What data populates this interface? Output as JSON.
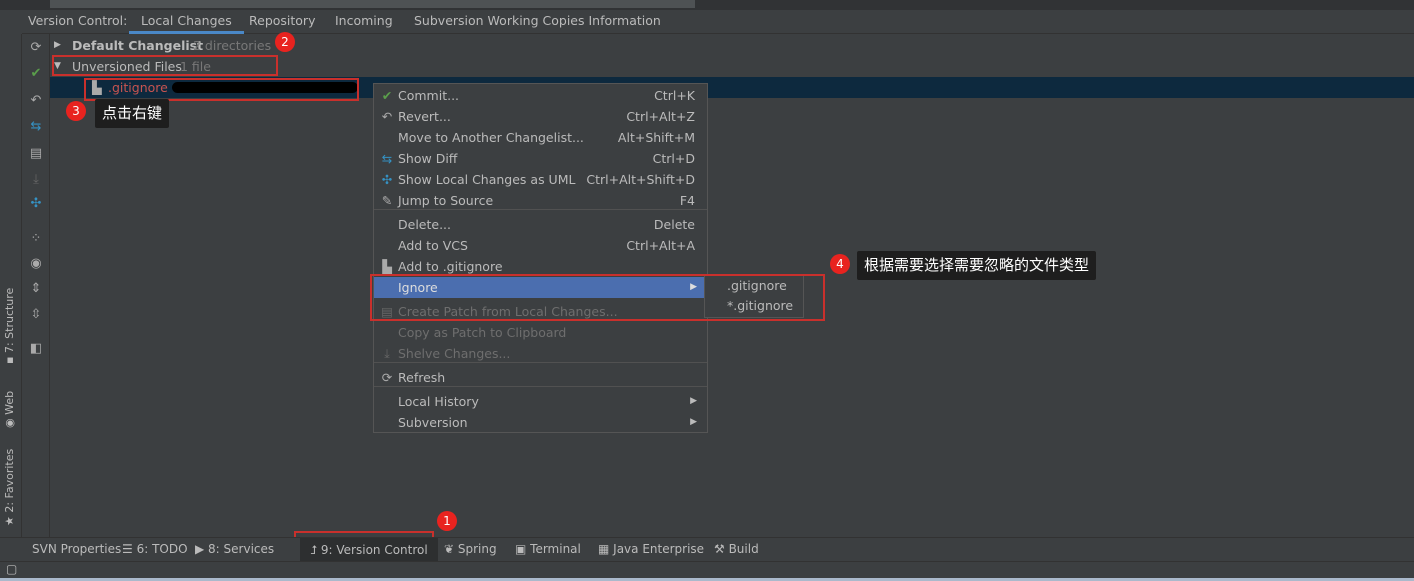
{
  "header": {
    "label": "Version Control:",
    "tabs": [
      {
        "label": "Local Changes",
        "active": true
      },
      {
        "label": "Repository"
      },
      {
        "label": "Incoming"
      },
      {
        "label": "Subversion Working Copies Information"
      }
    ]
  },
  "left_stripe": {
    "items": [
      {
        "label": "7: Structure",
        "icon": "structure-icon"
      },
      {
        "label": "Web",
        "icon": "globe-icon"
      },
      {
        "label": "2: Favorites",
        "icon": "star-icon"
      }
    ]
  },
  "toolbar": {
    "icons": [
      "refresh-icon",
      "commit-check-icon",
      "revert-icon",
      "show-diff-icon",
      "changelist-icon",
      "download-icon",
      "uml-icon",
      "group-icon",
      "eye-icon",
      "expand-all-icon",
      "collapse-all-icon",
      "preview-icon"
    ]
  },
  "tree": {
    "default_changelist": {
      "label": "Default Changelist",
      "meta": "2 directories"
    },
    "unversioned": {
      "label": "Unversioned Files",
      "meta": "1 file"
    },
    "file": {
      "name": ".gitignore"
    }
  },
  "context_menu": {
    "items": [
      {
        "label": "Commit...",
        "shortcut": "Ctrl+K",
        "icon": "check-icon"
      },
      {
        "label": "Revert...",
        "shortcut": "Ctrl+Alt+Z",
        "icon": "revert-icon"
      },
      {
        "label": "Move to Another Changelist...",
        "shortcut": "Alt+Shift+M"
      },
      {
        "label": "Show Diff",
        "shortcut": "Ctrl+D",
        "icon": "diff-icon"
      },
      {
        "label": "Show Local Changes as UML",
        "shortcut": "Ctrl+Alt+Shift+D",
        "icon": "uml-icon"
      },
      {
        "label": "Jump to Source",
        "shortcut": "F4",
        "icon": "edit-icon"
      },
      {
        "label": "Delete...",
        "shortcut": "Delete"
      },
      {
        "label": "Add to VCS",
        "shortcut": "Ctrl+Alt+A"
      },
      {
        "label": "Add to .gitignore",
        "icon": "gitignore-icon"
      },
      {
        "label": "Ignore",
        "submenu": true,
        "highlighted": true
      },
      {
        "label": "Create Patch from Local Changes...",
        "disabled": true,
        "icon": "patch-icon"
      },
      {
        "label": "Copy as Patch to Clipboard",
        "disabled": true
      },
      {
        "label": "Shelve Changes...",
        "disabled": true,
        "icon": "shelve-icon"
      },
      {
        "label": "Refresh",
        "icon": "refresh-icon"
      },
      {
        "label": "Local History",
        "submenu": true
      },
      {
        "label": "Subversion",
        "submenu": true
      }
    ]
  },
  "submenu": {
    "items": [
      ".gitignore",
      "*.gitignore"
    ]
  },
  "annotations": {
    "b1": "1",
    "b2": "2",
    "b3": "3",
    "b4": "4",
    "tip3": "点击右键",
    "tip4": "根据需要选择需要忽略的文件类型"
  },
  "bottom_bar": {
    "items": [
      {
        "label": "SVN Properties"
      },
      {
        "label": "6: TODO",
        "icon": "list-icon"
      },
      {
        "label": "8: Services",
        "icon": "services-icon"
      },
      {
        "label": "9: Version Control",
        "icon": "vcs-icon",
        "active": true
      },
      {
        "label": "Spring",
        "icon": "spring-icon"
      },
      {
        "label": "Terminal",
        "icon": "terminal-icon"
      },
      {
        "label": "Java Enterprise",
        "icon": "java-enterprise-icon"
      },
      {
        "label": "Build",
        "icon": "hammer-icon"
      }
    ]
  },
  "colors": {
    "selection": "#0d293e",
    "menu_highlight": "#4b6eaf",
    "annotation_red": "#e8231f",
    "tab_underline": "#4a88c7"
  }
}
